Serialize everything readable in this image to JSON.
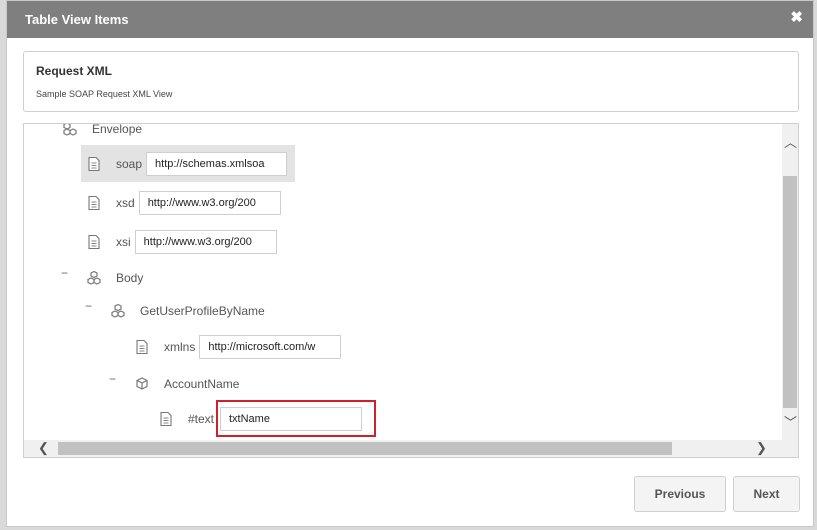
{
  "dialog": {
    "title": "Table View Items",
    "close_glyph": "✖"
  },
  "header": {
    "title": "Request XML",
    "subtitle": "Sample SOAP Request XML View"
  },
  "tree": {
    "envelope_label": "Envelope",
    "soap_label": "soap",
    "soap_value": "http://schemas.xmlsoa",
    "xsd_label": "xsd",
    "xsd_value": "http://www.w3.org/200",
    "xsi_label": "xsi",
    "xsi_value": "http://www.w3.org/200",
    "body_label": "Body",
    "get_user_label": "GetUserProfileByName",
    "xmlns_label": "xmlns",
    "xmlns_value": "http://microsoft.com/w",
    "account_label": "AccountName",
    "text_label": "#text",
    "text_value": "txtName",
    "collapse_glyph": "−"
  },
  "scroll": {
    "up": "︿",
    "down": "﹀",
    "left": "❮",
    "right": "❯"
  },
  "footer": {
    "previous_label": "Previous",
    "next_label": "Next"
  },
  "colors": {
    "titlebar": "#7f7f7f",
    "highlight": "#d0202e"
  }
}
